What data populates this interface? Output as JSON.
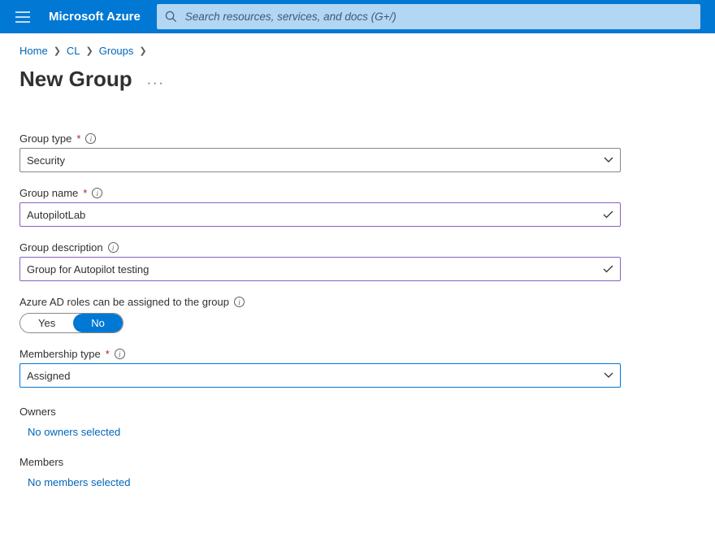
{
  "header": {
    "brand": "Microsoft Azure",
    "search_placeholder": "Search resources, services, and docs (G+/)"
  },
  "breadcrumb": {
    "items": [
      "Home",
      "CL",
      "Groups"
    ]
  },
  "page": {
    "title": "New Group"
  },
  "form": {
    "group_type": {
      "label": "Group type",
      "value": "Security"
    },
    "group_name": {
      "label": "Group name",
      "value": "AutopilotLab"
    },
    "group_description": {
      "label": "Group description",
      "value": "Group for Autopilot testing"
    },
    "aad_roles": {
      "label": "Azure AD roles can be assigned to the group",
      "yes": "Yes",
      "no": "No"
    },
    "membership_type": {
      "label": "Membership type",
      "value": "Assigned"
    },
    "owners": {
      "label": "Owners",
      "link": "No owners selected"
    },
    "members": {
      "label": "Members",
      "link": "No members selected"
    }
  }
}
